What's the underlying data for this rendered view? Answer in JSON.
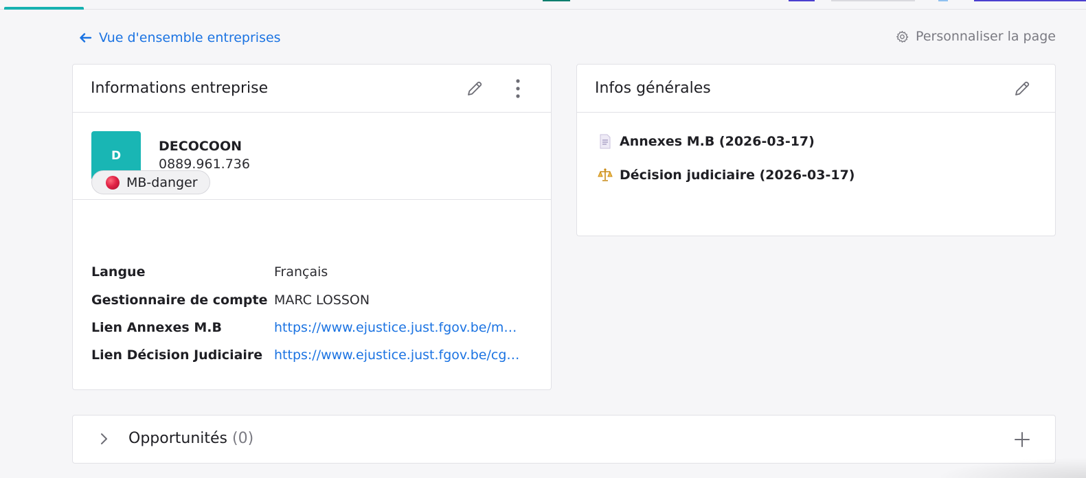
{
  "nav": {
    "back_label": "Vue d'ensemble entreprises",
    "customize_label": "Personnaliser la page"
  },
  "company_card": {
    "title": "Informations entreprise",
    "logo_letter": "D",
    "name": "DECOCOON",
    "number": "0889.961.736",
    "tag": "MB-danger",
    "fields": [
      {
        "label": "Langue",
        "value": "Français"
      },
      {
        "label": "Gestionnaire de compte",
        "value": "MARC LOSSON"
      },
      {
        "label": "Lien Annexes M.B",
        "value": "https://www.ejustice.just.fgov.be/m…"
      },
      {
        "label": "Lien Décision Judiciaire",
        "value": "https://www.ejustice.just.fgov.be/cg…"
      }
    ]
  },
  "general_card": {
    "title": "Infos générales",
    "items": [
      {
        "icon": "document-icon",
        "label": "Annexes M.B (2026-03-17)"
      },
      {
        "icon": "scales-icon",
        "label": "Décision judiciaire (2026-03-17)"
      }
    ]
  },
  "opportunities": {
    "title": "Opportunités",
    "count": "(0)"
  },
  "colors": {
    "accent": "#16b1b0",
    "link": "#1b73e2",
    "danger": "#e12245"
  }
}
